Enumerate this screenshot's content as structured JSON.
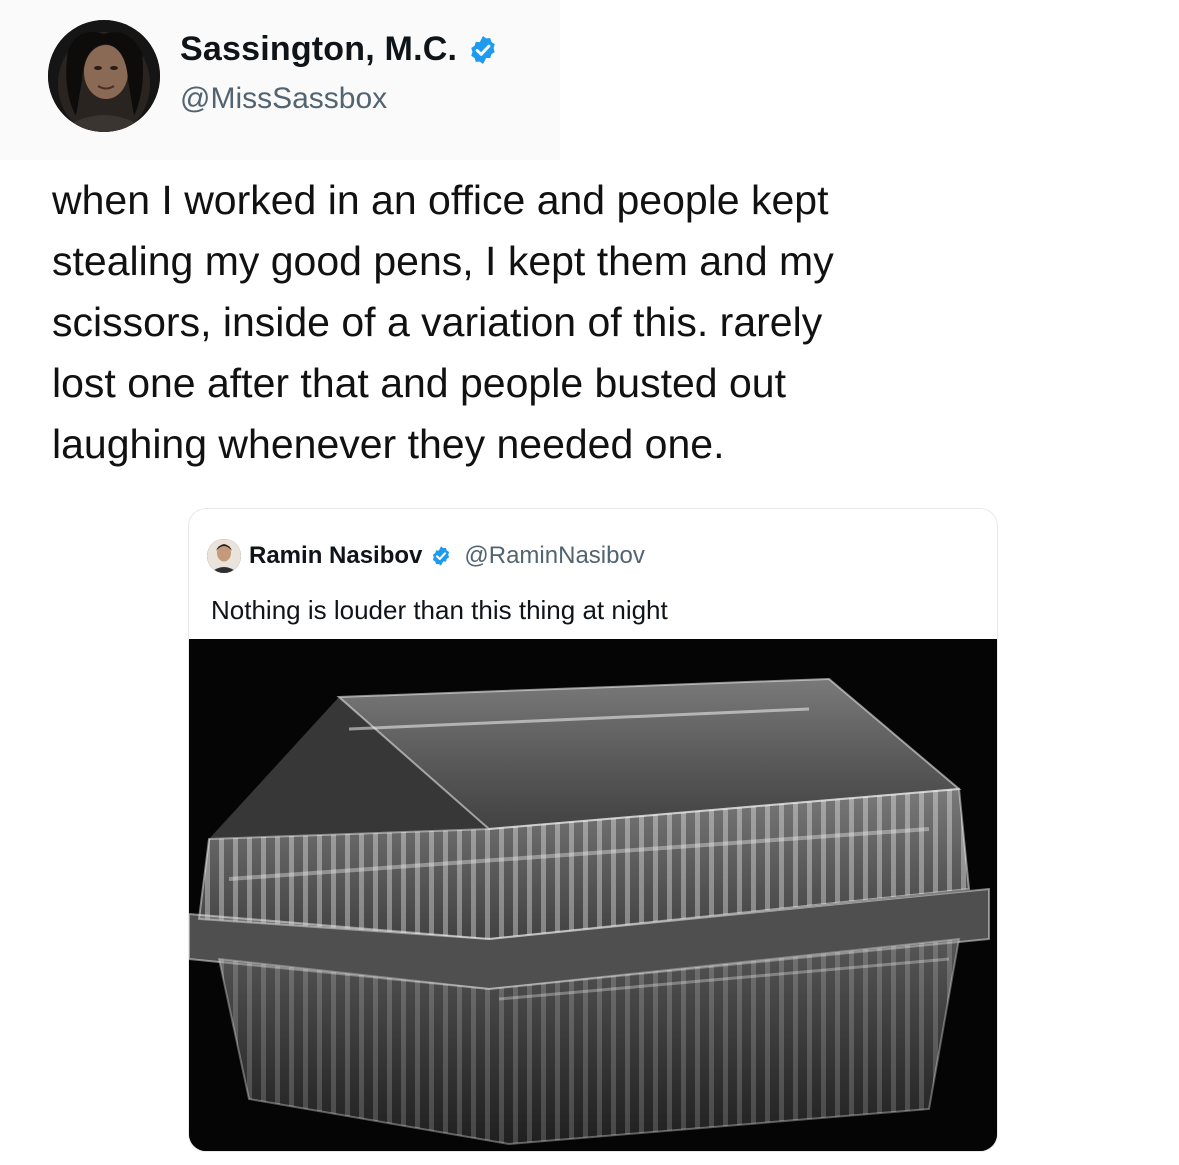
{
  "author": {
    "name": "Sassington, M.C.",
    "handle": "@MissSassbox",
    "verified": true
  },
  "tweet": {
    "text": "when I worked in an office and people kept\nstealing my good pens, I kept them and my\nscissors, inside of a variation of this. rarely\nlost one after that and people busted out\nlaughing whenever they needed one."
  },
  "quoted": {
    "name": "Ramin Nasibov",
    "handle": "@RaminNasibov",
    "verified": true,
    "text": "Nothing is louder than this thing at night",
    "image_icon": "clear-plastic-clamshell-container"
  },
  "colors": {
    "verified_blue": "#1d9bf0",
    "muted_text": "#536471",
    "image_bg": "#050505"
  }
}
